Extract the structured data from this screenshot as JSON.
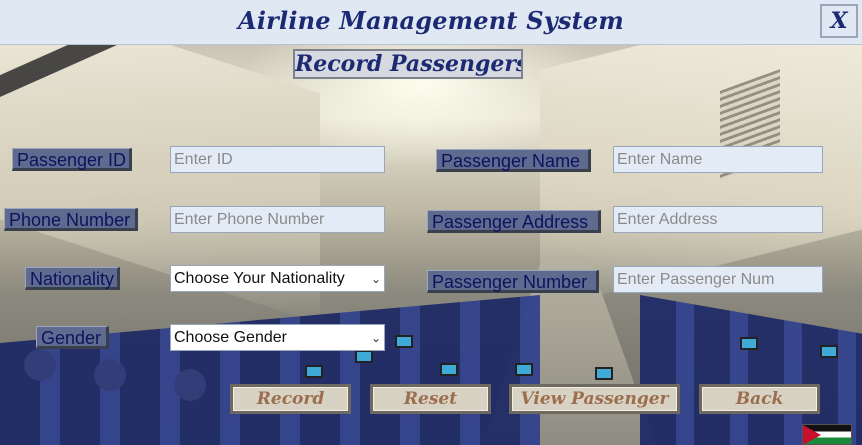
{
  "window": {
    "title": "Airline Management System",
    "close_label": "X"
  },
  "form": {
    "heading": "Record Passengers",
    "fields": {
      "passenger_id": {
        "label": "Passenger ID",
        "placeholder": "Enter ID"
      },
      "passenger_name": {
        "label": "Passenger Name",
        "placeholder": "Enter Name"
      },
      "phone_number": {
        "label": "Phone Number",
        "placeholder": "Enter Phone Number"
      },
      "passenger_address": {
        "label": "Passenger Address",
        "placeholder": "Enter Address"
      },
      "nationality": {
        "label": "Nationality",
        "selected": "Choose Your Nationality"
      },
      "passenger_number": {
        "label": "Passenger Number",
        "placeholder": "Enter Passenger Num"
      },
      "gender": {
        "label": "Gender",
        "selected": "Choose Gender"
      }
    }
  },
  "actions": {
    "record": "Record",
    "reset": "Reset",
    "view_passenger": "View Passenger",
    "back": "Back"
  },
  "icons": {
    "close": "close-icon",
    "dropdown": "chevron-down-icon",
    "flag": "flag-icon"
  },
  "colors": {
    "title_text": "#1c2a73",
    "label_bg": "#5e6b8e",
    "label_text": "#10125e",
    "input_bg": "#e3ecf6",
    "action_text": "#9b6e4e"
  }
}
